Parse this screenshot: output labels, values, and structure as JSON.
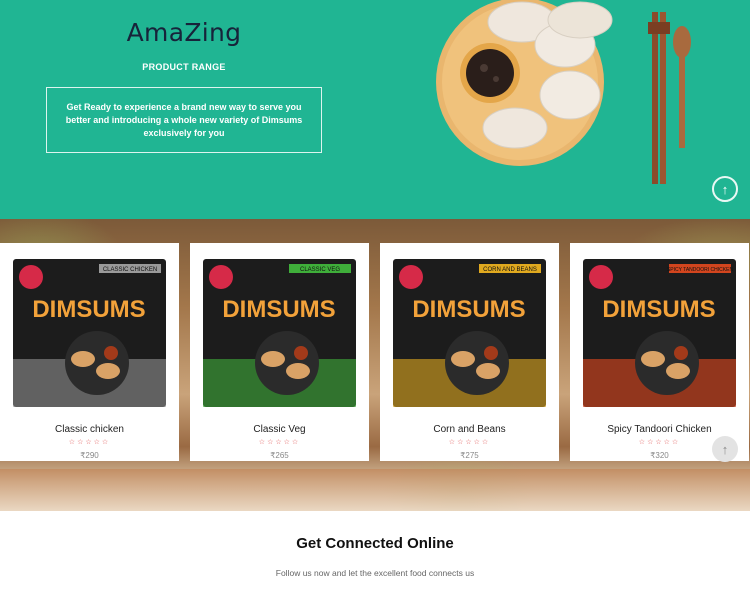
{
  "hero": {
    "brand": "AmaZing",
    "subtitle": "PRODUCT RANGE",
    "intro": "Get Ready to experience a brand new way to serve you better and introducing a whole new variety of Dimsums exclusively for you",
    "colors": {
      "background": "#20b593",
      "brand_text": "#17233a"
    }
  },
  "scroll_top_icon": "arrow-up-icon",
  "products": [
    {
      "name": "Classic chicken",
      "price": "₹290",
      "rating": "☆☆☆☆☆",
      "pack_label": "CLASSIC CHICKEN",
      "pack_title": "DIMSUMS",
      "pack_color": "#9a9a9a"
    },
    {
      "name": "Classic Veg",
      "price": "₹265",
      "rating": "☆☆☆☆☆",
      "pack_label": "CLASSIC VEG",
      "pack_title": "DIMSUMS",
      "pack_color": "#3fae3a"
    },
    {
      "name": "Corn and Beans",
      "price": "₹275",
      "rating": "☆☆☆☆☆",
      "pack_label": "CORN AND BEANS",
      "pack_title": "DIMSUMS",
      "pack_color": "#e0a91f"
    },
    {
      "name": "Spicy Tandoori Chicken",
      "price": "₹320",
      "rating": "☆☆☆☆☆",
      "pack_label": "SPICY TANDOORI CHICKEN",
      "pack_title": "DIMSUMS",
      "pack_color": "#d2451e"
    }
  ],
  "connect": {
    "title": "Get Connected Online",
    "subtitle": "Follow us now and let the excellent food connects us"
  }
}
